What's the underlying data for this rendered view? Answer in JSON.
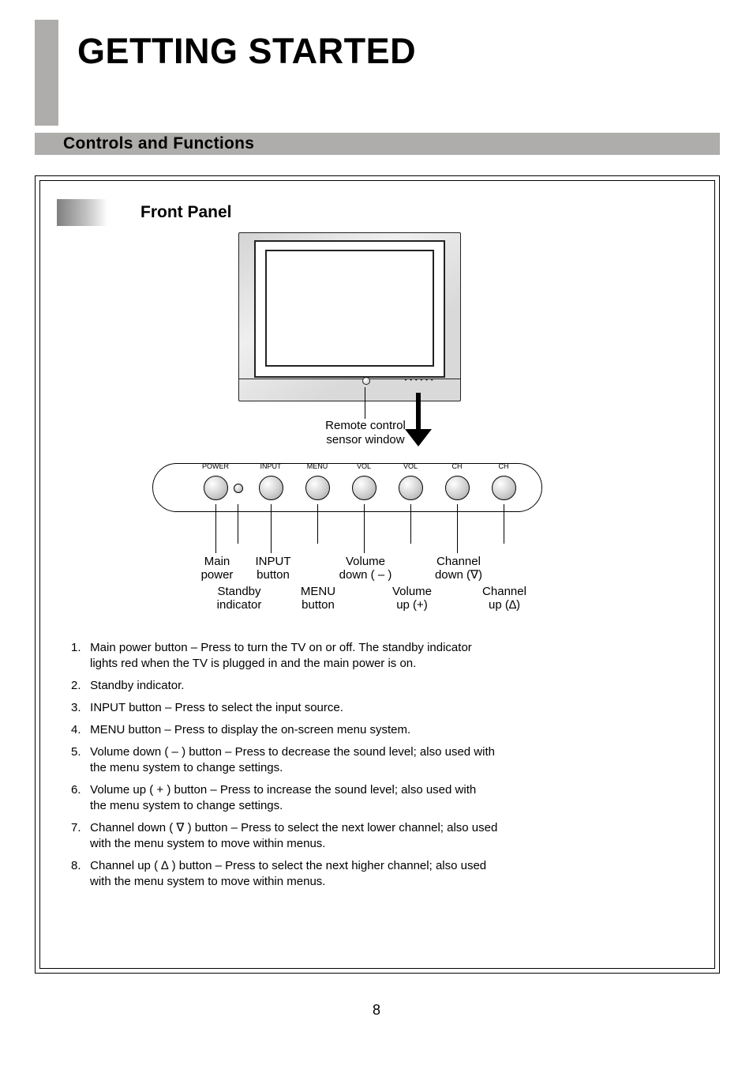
{
  "page_number": "8",
  "title": "GETTING STARTED",
  "controls_heading": "Controls and Functions",
  "front_panel_label": "Front Panel",
  "sensor_caption": "Remote control\nsensor window",
  "button_mini_labels": {
    "power": "POWER",
    "input": "INPUT",
    "menu": "MENU",
    "vol_down": "VOL",
    "vol_up": "VOL",
    "ch_down": "CH",
    "ch_up": "CH"
  },
  "captions": {
    "c1": "Main\npower",
    "c2": "Standby\nindicator",
    "c3": "INPUT\nbutton",
    "c4": "MENU\nbutton",
    "c5": "Volume\ndown ( – )",
    "c6": "Volume\nup (+)",
    "c7": "Channel\ndown (∇)",
    "c8": "Channel\nup (∆)"
  },
  "desc": {
    "d1_n": "1.",
    "d1": "Main power button – Press to turn the TV on or off.  The standby indicator",
    "d1b": "lights red when the TV is plugged in and the main power is on.",
    "d2_n": "2.",
    "d2": "Standby indicator.",
    "d3_n": "3.",
    "d3": "INPUT button  – Press to select the input source.",
    "d4_n": "4.",
    "d4": "MENU button  – Press to display the on-screen menu system.",
    "d5_n": "5.",
    "d5": "Volume down ( – ) button  – Press to decrease the sound level; also used with",
    "d5b": "the menu system to change settings.",
    "d6_n": "6.",
    "d6": "Volume up ( + ) button  – Press to increase the sound level; also used with",
    "d6b": "the menu system to change settings.",
    "d7_n": "7.",
    "d7": "Channel down ( ∇ ) button  – Press to select the next lower channel; also used",
    "d7b": "with the menu system to move within menus.",
    "d8_n": "8.",
    "d8": "Channel up ( ∆ ) button  – Press to select the next higher channel; also used",
    "d8b": "with the menu system to move within menus."
  }
}
